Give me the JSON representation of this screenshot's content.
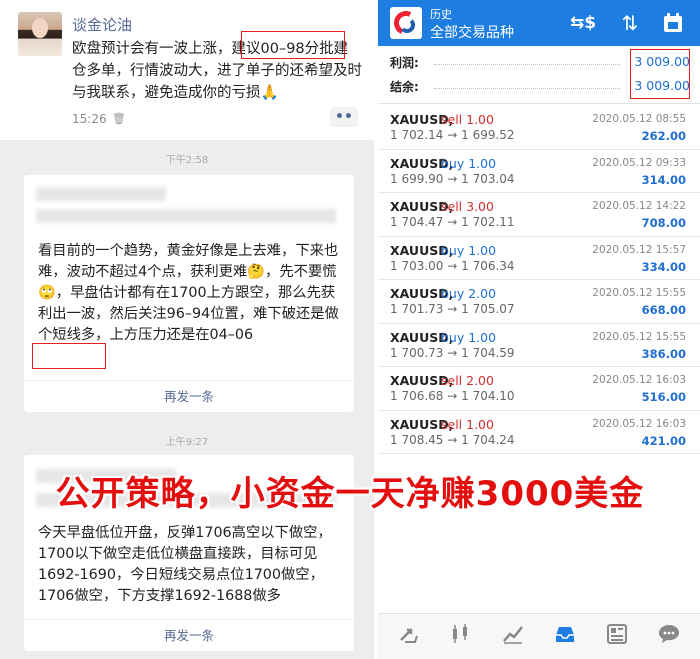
{
  "chat": {
    "post1": {
      "author": "谈金论油",
      "text": "欧盘预计会有一波上涨，建议00–98分批建仓多单，行情波动大，进了单子的还希望及时与我联系，避免造成你的亏损🙏",
      "time": "15:26",
      "more_label": "••"
    },
    "post2": {
      "time": "下午2:58",
      "text": "看目前的一个趋势，黄金好像是上去难，下来也难，波动不超过4个点，获利更难🤔，先不要慌🙄，早盘估计都有在1700上方跟空，那么先获利出一波，然后关注96–94位置，难下破还是做个短线多，上方压力还是在04–06",
      "footer": "再发一条"
    },
    "post3": {
      "time": "上午9:27",
      "text": "今天早盘低位开盘，反弹1706高空以下做空，1700以下做空走低位横盘直接跌，目标可见1692-1690，今日短线交易点位1700做空，1706做空，下方支撑1692-1688做多",
      "footer": "再发一条"
    }
  },
  "headline": "公开策略，小资金一天净赚3000美金",
  "app": {
    "header_sub": "历史",
    "header_title": "全部交易品种",
    "icons": {
      "currency": "currency-exchange-icon",
      "sort": "sort-icon",
      "calendar": "calendar-icon"
    },
    "summary": {
      "profit_label": "利润:",
      "profit_value": "3 009.00",
      "balance_label": "结余:",
      "balance_value": "3 009.00"
    },
    "trades": [
      {
        "symbol": "XAUUSD,",
        "side": "sell 1.00",
        "type": "sell",
        "prices": "1 702.14 → 1 699.52",
        "date": "2020.05.12 08:55",
        "profit": "262.00"
      },
      {
        "symbol": "XAUUSD,",
        "side": "buy 1.00",
        "type": "buy",
        "prices": "1 699.90 → 1 703.04",
        "date": "2020.05.12 09:33",
        "profit": "314.00"
      },
      {
        "symbol": "XAUUSD,",
        "side": "sell 3.00",
        "type": "sell",
        "prices": "1 704.47 → 1 702.11",
        "date": "2020.05.12 14:22",
        "profit": "708.00"
      },
      {
        "symbol": "XAUUSD,",
        "side": "buy 1.00",
        "type": "buy",
        "prices": "1 703.00 → 1 706.34",
        "date": "2020.05.12 15:57",
        "profit": "334.00"
      },
      {
        "symbol": "XAUUSD,",
        "side": "buy 2.00",
        "type": "buy",
        "prices": "1 701.73 → 1 705.07",
        "date": "2020.05.12 15:55",
        "profit": "668.00"
      },
      {
        "symbol": "XAUUSD,",
        "side": "buy 1.00",
        "type": "buy",
        "prices": "1 700.73 → 1 704.59",
        "date": "2020.05.12 15:55",
        "profit": "386.00"
      },
      {
        "symbol": "XAUUSD,",
        "side": "sell 2.00",
        "type": "sell",
        "prices": "1 706.68 → 1 704.10",
        "date": "2020.05.12 16:03",
        "profit": "516.00"
      },
      {
        "symbol": "XAUUSD,",
        "side": "sell 1.00",
        "type": "sell",
        "prices": "1 708.45 → 1 704.24",
        "date": "2020.05.12 16:03",
        "profit": "421.00"
      }
    ],
    "nav": [
      "trade-icon",
      "chart-candles-icon",
      "chart-line-icon",
      "history-inbox-icon",
      "news-icon",
      "chat-icon"
    ],
    "accent_color": "#1e7de1",
    "sell_color": "#d23030",
    "buy_color": "#1e6fd0",
    "highlight_color": "#e02020"
  }
}
